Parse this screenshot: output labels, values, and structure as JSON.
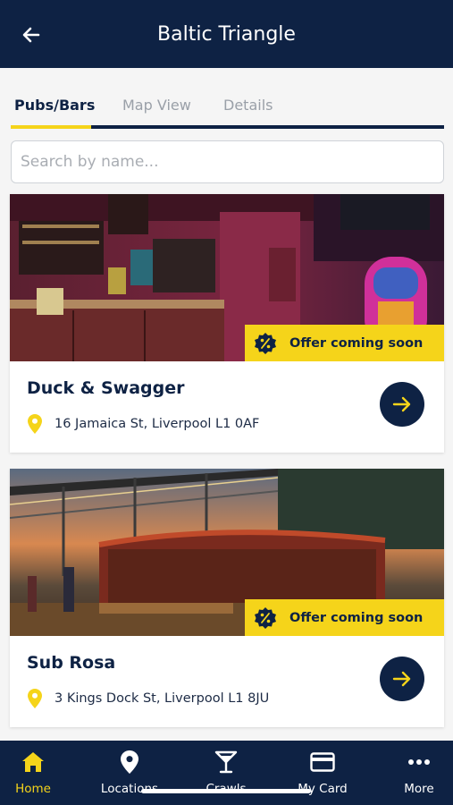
{
  "header": {
    "title": "Baltic Triangle",
    "back_icon": "arrow-left-icon"
  },
  "tabs": [
    {
      "label": "Pubs/Bars",
      "active": true
    },
    {
      "label": "Map View",
      "active": false
    },
    {
      "label": "Details",
      "active": false
    }
  ],
  "search": {
    "placeholder": "Search by name...",
    "value": ""
  },
  "venues": [
    {
      "name": "Duck & Swagger",
      "address": "16 Jamaica St, Liverpool L1 0AF",
      "offer": "Offer coming soon"
    },
    {
      "name": "Sub Rosa",
      "address": "3 Kings Dock St, Liverpool L1 8JU",
      "offer": "Offer coming soon"
    }
  ],
  "bottom_nav": [
    {
      "label": "Home",
      "icon": "home-icon",
      "active": true
    },
    {
      "label": "Locations",
      "icon": "location-pin-icon",
      "active": false
    },
    {
      "label": "Crawls",
      "icon": "cocktail-glass-icon",
      "active": false
    },
    {
      "label": "My Card",
      "icon": "credit-card-icon",
      "active": false
    },
    {
      "label": "More",
      "icon": "more-dots-icon",
      "active": false
    }
  ],
  "colors": {
    "navy": "#0e2244",
    "accent_yellow": "#f5d41a"
  }
}
